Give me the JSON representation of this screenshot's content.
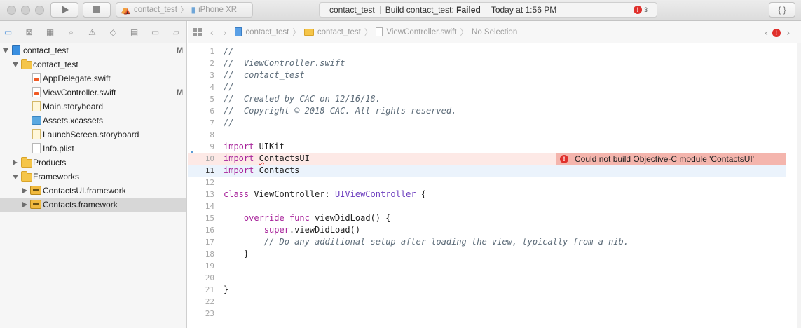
{
  "toolbar": {
    "scheme_target": "contact_test",
    "scheme_device": "iPhone XR",
    "activity_project": "contact_test",
    "activity_status_prefix": "Build contact_test:",
    "activity_status_result": "Failed",
    "activity_time": "Today at 1:56 PM",
    "error_count": "3",
    "error_glyph": "!",
    "code_review_label": "{ }"
  },
  "navigator": {
    "items": [
      {
        "label": "contact_test",
        "flag": "M"
      },
      {
        "label": "contact_test"
      },
      {
        "label": "AppDelegate.swift"
      },
      {
        "label": "ViewController.swift",
        "flag": "M"
      },
      {
        "label": "Main.storyboard"
      },
      {
        "label": "Assets.xcassets"
      },
      {
        "label": "LaunchScreen.storyboard"
      },
      {
        "label": "Info.plist"
      },
      {
        "label": "Products"
      },
      {
        "label": "Frameworks"
      },
      {
        "label": "ContactsUI.framework"
      },
      {
        "label": "Contacts.framework"
      }
    ]
  },
  "jumpbar": {
    "project": "contact_test",
    "group": "contact_test",
    "file": "ViewController.swift",
    "selection": "No Selection"
  },
  "editor": {
    "line_numbers": [
      "1",
      "2",
      "3",
      "4",
      "5",
      "6",
      "7",
      "8",
      "9",
      "10",
      "11",
      "12",
      "13",
      "14",
      "15",
      "16",
      "17",
      "18",
      "19",
      "20",
      "21",
      "22",
      "23"
    ],
    "l1": "//",
    "l2": "//  ViewController.swift",
    "l3": "//  contact_test",
    "l4": "//",
    "l5": "//  Created by CAC on 12/16/18.",
    "l6": "//  Copyright © 2018 CAC. All rights reserved.",
    "l7": "//",
    "kw_import": "import",
    "l9_mod": " UIKit",
    "l10_c": "C",
    "l10_rest": "ontactsUI",
    "l11_mod": " Contacts",
    "kw_class": "class",
    "l13_name": " ViewController: ",
    "l13_super": "UIViewController",
    "l13_brace": " {",
    "l15_indent": "    ",
    "kw_override": "override",
    "kw_func": "func",
    "l15_sig": " viewDidLoad() {",
    "l16_indent": "        ",
    "kw_super": "super",
    "l16_call": ".viewDidLoad()",
    "l17": "        // Do any additional setup after loading the view, typically from a nib.",
    "l18": "    }",
    "l21": "}",
    "error_message": "Could not build Objective-C module 'ContactsUI'"
  },
  "colors": {
    "keyword": "#a8259b",
    "comment": "#5d6c79",
    "type": "#6d3fbf",
    "error": "#e0302c",
    "error_bubble": "#f4b5ad",
    "error_line_bg": "#fde9e6",
    "current_line_bg": "#ebf3fc"
  },
  "icons": {
    "navigator_tabs": [
      "folder-icon",
      "source-control-icon",
      "hierarchy-icon",
      "search-icon",
      "warning-icon",
      "test-icon",
      "debug-icon",
      "breakpoint-icon",
      "report-icon"
    ]
  }
}
